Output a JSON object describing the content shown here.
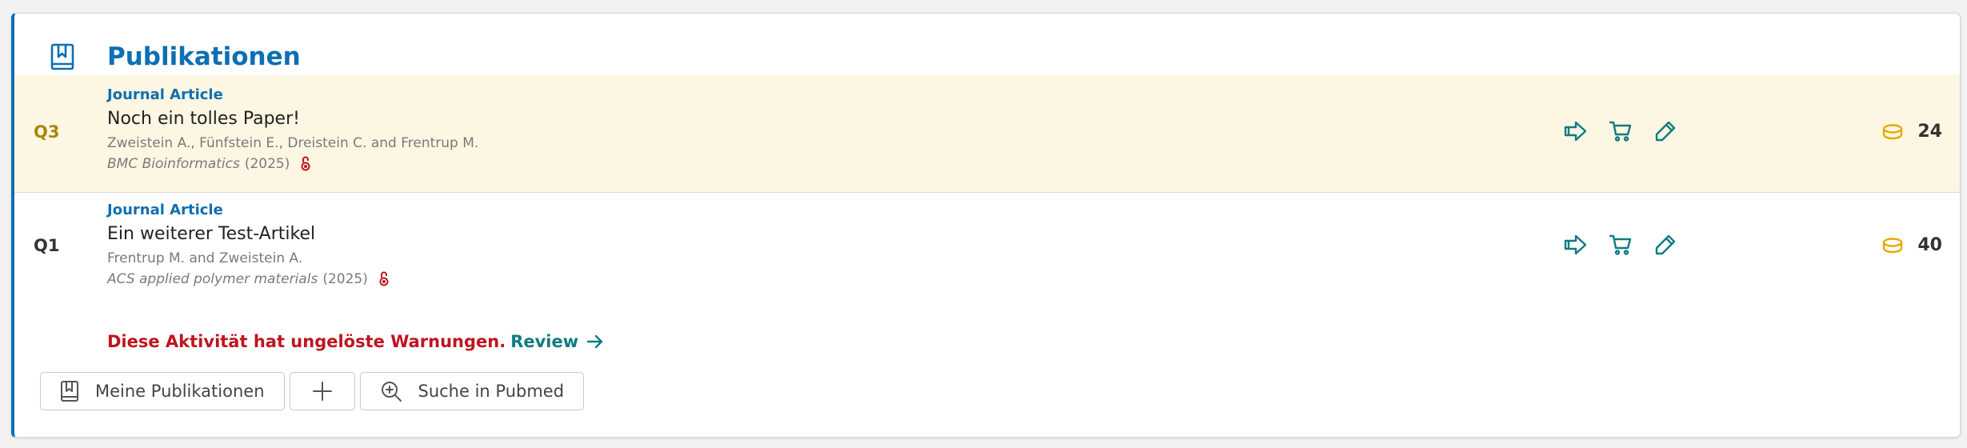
{
  "section": {
    "title": "Publikationen",
    "icon": "bookmark-book-icon"
  },
  "publications": [
    {
      "quartile": "Q3",
      "type": "Journal Article",
      "title": "Noch ein tolles Paper!",
      "authors": "Zweistein A., Fünfstein E., Dreistein C. and Frentrup M.",
      "journal": "BMC Bioinformatics",
      "year": "(2025)",
      "points": "24",
      "highlighted": true
    },
    {
      "quartile": "Q1",
      "type": "Journal Article",
      "title": "Ein weiterer Test-Artikel",
      "authors": "Frentrup M. and Zweistein A.",
      "journal": "ACS applied polymer materials",
      "year": "(2025)",
      "points": "40",
      "highlighted": false
    }
  ],
  "row_actions": [
    "share-arrow-icon",
    "cart-icon",
    "pencil-icon"
  ],
  "warning": {
    "text": "Diese Aktivität hat ungelöste Warnungen.",
    "link": "Review"
  },
  "buttons": {
    "my_publications": "Meine Publikationen",
    "search_pubmed": "Suche in Pubmed"
  },
  "colors": {
    "accent_blue": "#0d6fb3",
    "teal": "#0f7b82",
    "warning_red": "#c0141f",
    "q3_gold": "#a8860f",
    "highlight_row": "#fdf6e3",
    "coin": "#e6a800"
  }
}
